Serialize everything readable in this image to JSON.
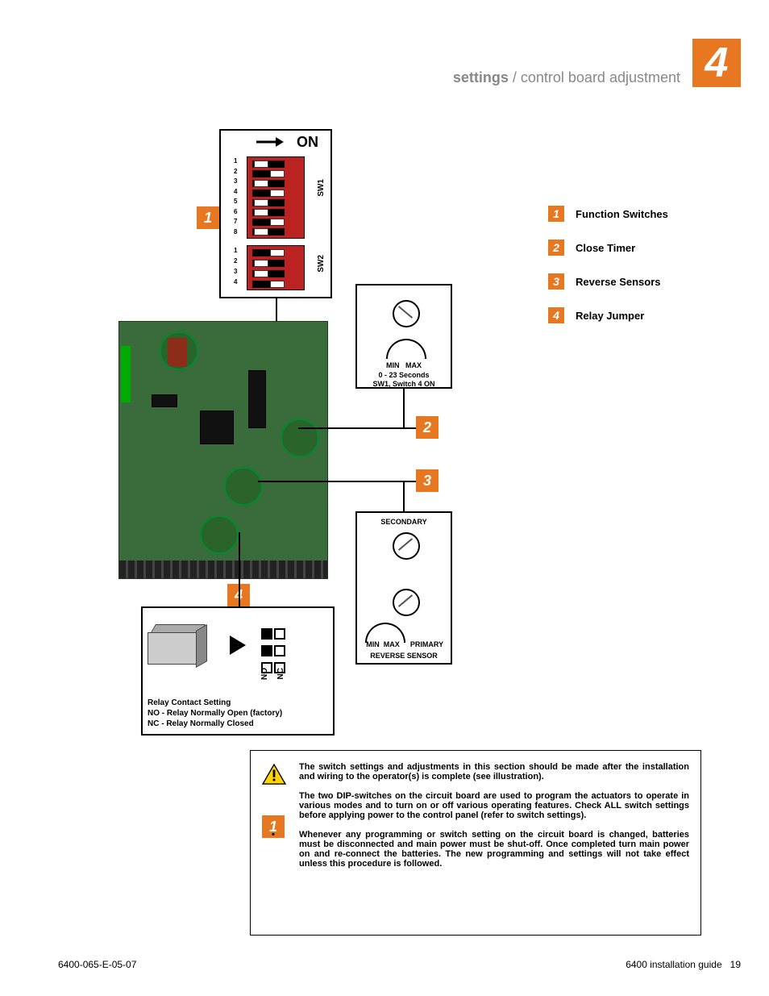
{
  "chapter_number": "4",
  "breadcrumb": {
    "bold": "settings",
    "rest": " / control board adjustment"
  },
  "dip": {
    "on_label": "ON",
    "sw1_name": "SW1",
    "sw2_name": "SW2",
    "sw1_numbers": [
      "1",
      "2",
      "3",
      "4",
      "5",
      "6",
      "7",
      "8"
    ],
    "sw2_numbers": [
      "1",
      "2",
      "3",
      "4"
    ]
  },
  "callouts": {
    "c1": "1",
    "c2": "2",
    "c3": "3",
    "c4": "4"
  },
  "legend": {
    "items": [
      {
        "num": "1",
        "label": "Function Switches"
      },
      {
        "num": "2",
        "label": "Close Timer"
      },
      {
        "num": "3",
        "label": "Reverse Sensors"
      },
      {
        "num": "4",
        "label": "Relay Jumper"
      }
    ]
  },
  "close_timer": {
    "min": "MIN",
    "max": "MAX",
    "line1": "0 - 23 Seconds",
    "line2": "SW1, Switch 4 ON"
  },
  "reverse": {
    "secondary": "SECONDARY",
    "primary": "PRIMARY",
    "min": "MIN",
    "max": "MAX",
    "title": "REVERSE SENSOR"
  },
  "relay": {
    "no": "NO",
    "nc": "NC",
    "note_l1": "Relay Contact Setting",
    "note_l2": "NO - Relay Normally Open (factory)",
    "note_l3": "NC - Relay Normally Closed"
  },
  "info": {
    "p1": "The switch settings and adjustments in this section should be made after the installation and wiring to the operator(s) is complete (see illustration).",
    "p2": "The two DIP-switches on the circuit board are used to program the actuators to operate in various modes and to turn on or off various operating features.  Check ALL switch settings before applying power to the control panel (refer to switch settings).",
    "p3": "Whenever any programming or switch setting on the circuit board is changed, batteries must be disconnected and main power must be shut-off.  Once completed turn main power on and re-connect the batteries.  The new programming and settings will not take effect unless this procedure is followed.",
    "badge": "1"
  },
  "footer": {
    "left": "6400-065-E-05-07",
    "right_doc": "6400 installation guide",
    "right_page": "19"
  }
}
